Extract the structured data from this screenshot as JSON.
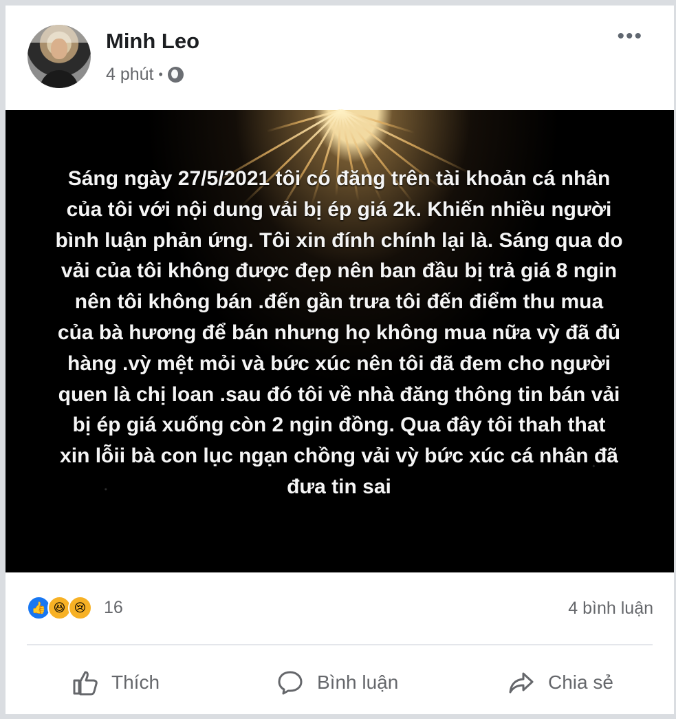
{
  "post": {
    "author": "Minh Leo",
    "time": "4 phút",
    "separator": "•",
    "privacy_icon": "globe-icon",
    "menu_icon": "more-options-icon",
    "text": "Sáng ngày 27/5/2021 tôi có đăng trên tài khoản cá nhân của tôi với nội dung vải bị ép giá 2k. Khiến nhiều người bình luận phản ứng. Tôi xin đính chính lại là. Sáng qua do vải của tôi không được đẹp nên ban đầu bị trả giá 8 ngin nên tôi không bán .đến gần trưa tôi đến điểm thu mua của bà hương để bán nhưng họ không mua nữa vỳ đã đủ hàng .vỳ mệt mỏi và bức xúc nên tôi đã đem cho người quen là chị loan .sau đó tôi về nhà đăng thông tin bán vải bị ép giá xuống còn 2 ngin đồng. Qua đây tôi thah that xin lỗii bà con lục ngạn chồng vải vỳ bức xúc cá nhân đã đưa tin sai"
  },
  "reactions": {
    "icons": [
      "like-icon",
      "haha-icon",
      "sad-icon"
    ],
    "count": "16",
    "comments": "4 bình luận"
  },
  "actions": {
    "like": "Thích",
    "comment": "Bình luận",
    "share": "Chia sẻ"
  }
}
